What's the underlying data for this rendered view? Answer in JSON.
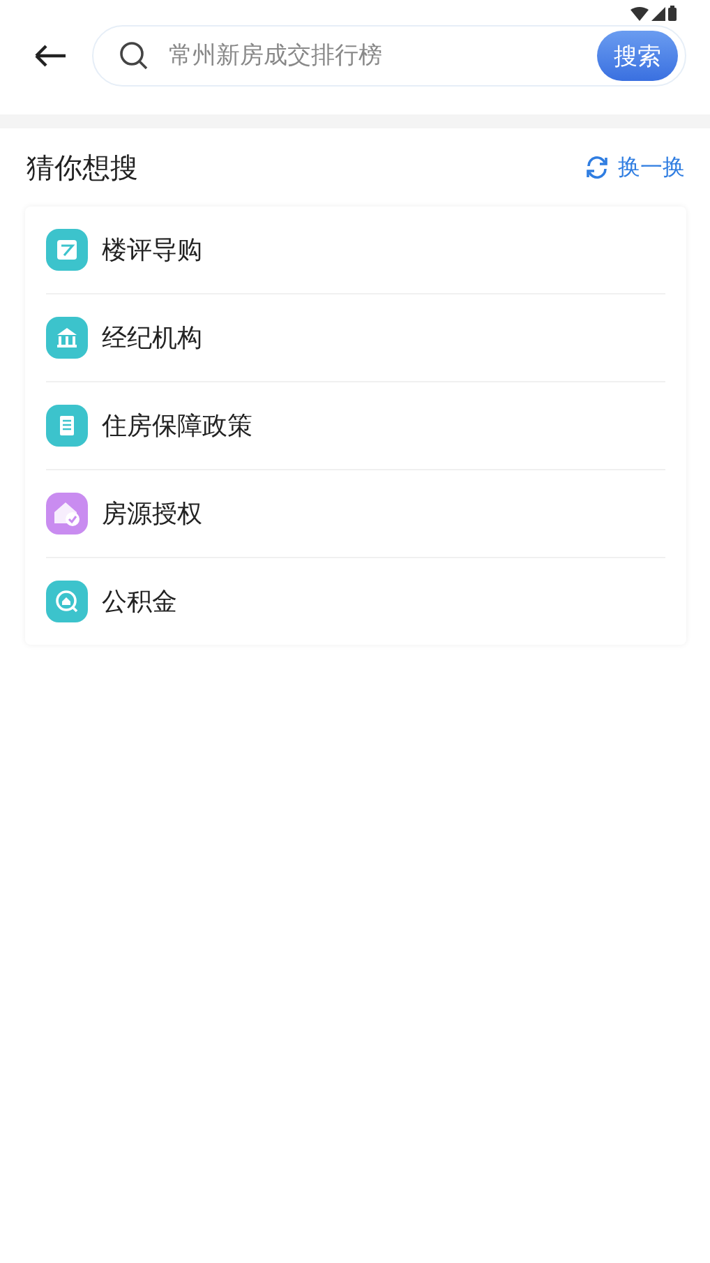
{
  "search": {
    "placeholder": "常州新房成交排行榜",
    "button": "搜索"
  },
  "section": {
    "title": "猜你想搜",
    "refresh": "换一换"
  },
  "items": [
    {
      "label": "楼评导购",
      "kind": "note",
      "color": "#3cc3cc"
    },
    {
      "label": "经纪机构",
      "kind": "bank",
      "color": "#3cc3cc"
    },
    {
      "label": "住房保障政策",
      "kind": "list",
      "color": "#3cc3cc"
    },
    {
      "label": "房源授权",
      "kind": "house-check",
      "color": "#c98cf0"
    },
    {
      "label": "公积金",
      "kind": "house-search",
      "color": "#3cc3cc"
    }
  ]
}
